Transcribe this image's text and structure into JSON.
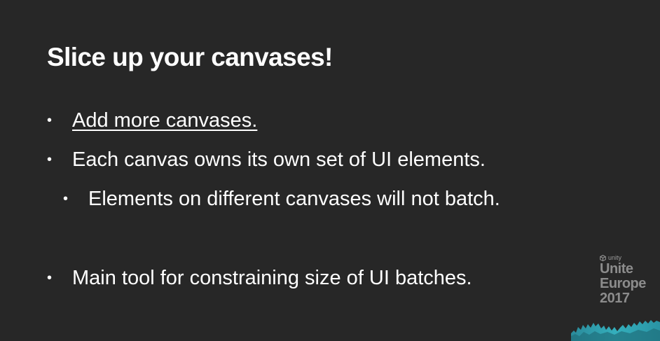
{
  "slide": {
    "title": "Slice up your canvases!",
    "bullets": [
      {
        "text": "Add more canvases.",
        "level": 1,
        "link": true
      },
      {
        "text": "Each canvas owns its own set of UI elements.",
        "level": 1,
        "link": false
      },
      {
        "text": "Elements on different canvases will not batch.",
        "level": 2,
        "link": false
      },
      {
        "text": "Main tool for constraining size of UI batches.",
        "level": 1,
        "link": false
      }
    ],
    "bullet_symbol": "•"
  },
  "branding": {
    "icon": "unity-logo-icon",
    "brand": "unity",
    "event_lines": [
      "Unite",
      "Europe",
      "2017"
    ],
    "wave_color": "#35b6c4"
  },
  "colors": {
    "background": "#272727",
    "text": "#ffffff",
    "logo_text": "#8c8c8c"
  }
}
